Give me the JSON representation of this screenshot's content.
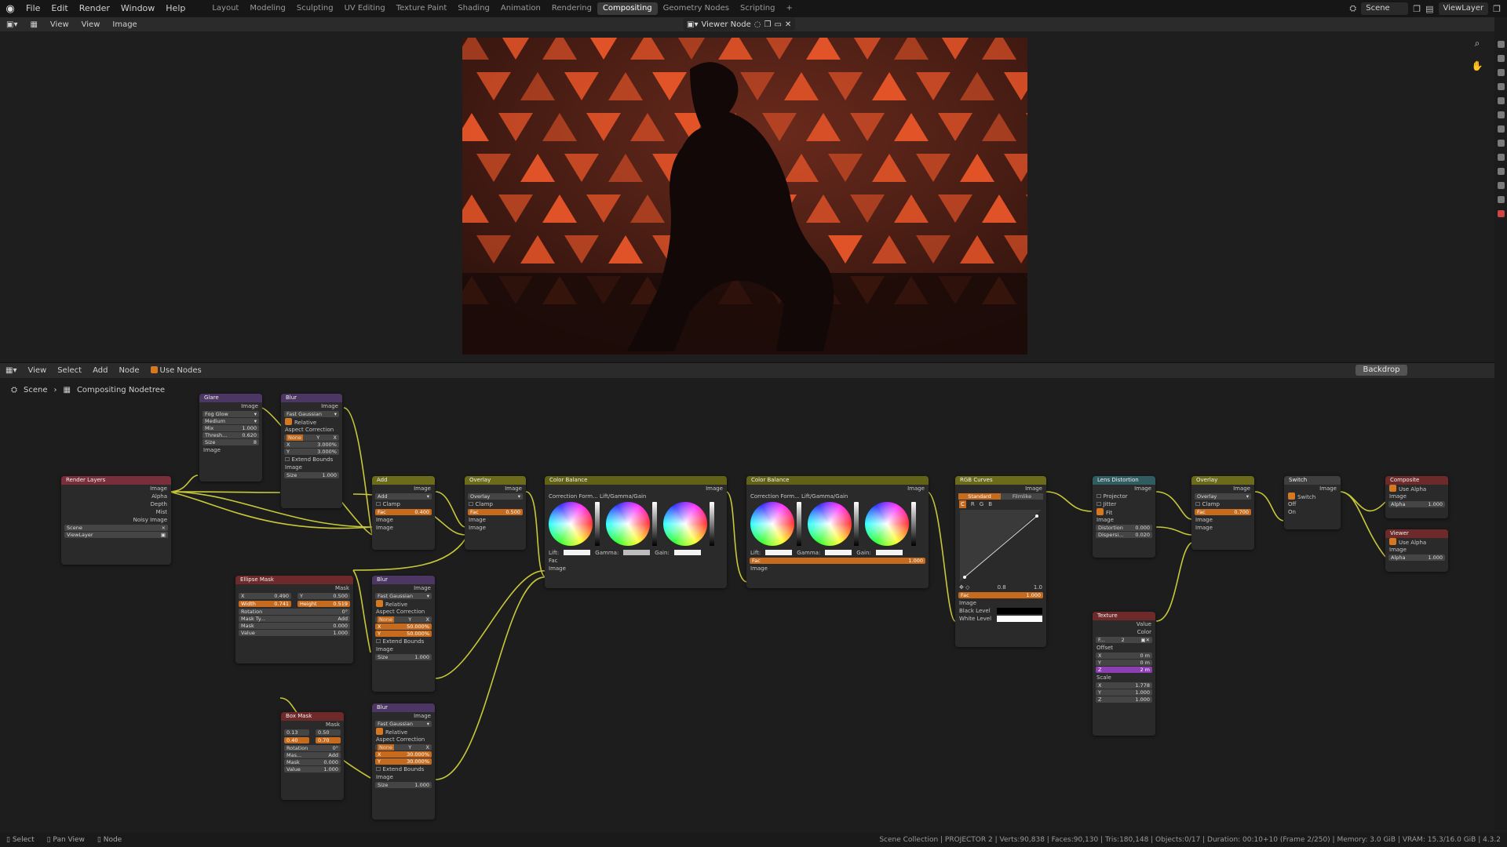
{
  "menu": {
    "file": "File",
    "edit": "Edit",
    "render": "Render",
    "window": "Window",
    "help": "Help"
  },
  "workspaces": [
    "Layout",
    "Modeling",
    "Sculpting",
    "UV Editing",
    "Texture Paint",
    "Shading",
    "Animation",
    "Rendering",
    "Compositing",
    "Geometry Nodes",
    "Scripting"
  ],
  "active_workspace": "Compositing",
  "scene_selector": "Scene",
  "viewlayer_selector": "ViewLayer",
  "image_editor": {
    "view": "View",
    "view2": "View",
    "image": "Image",
    "viewer_node": "Viewer Node"
  },
  "node_editor": {
    "view": "View",
    "select": "Select",
    "add": "Add",
    "node": "Node",
    "use_nodes": "Use Nodes",
    "backdrop": "Backdrop",
    "breadcrumb_scene": "Scene",
    "breadcrumb_tree": "Compositing Nodetree"
  },
  "nodes": {
    "render_layers": {
      "title": "Render Layers",
      "outputs": [
        "Image",
        "Alpha",
        "Depth",
        "Mist",
        "Noisy Image"
      ],
      "scene": "Scene",
      "layer": "ViewLayer"
    },
    "glare": {
      "title": "Glare",
      "out": "Image",
      "type": "Fog Glow",
      "quality": "Medium",
      "mix": "Mix",
      "mix_v": "1.000",
      "thresh": "Thresh...",
      "thresh_v": "0.620",
      "size": "Size",
      "size_v": "8",
      "in": "Image"
    },
    "blur1": {
      "title": "Blur",
      "out": "Image",
      "type": "Fast Gaussian",
      "relative": "Relative",
      "aspect": "Aspect Correction",
      "none": "None",
      "y": "Y",
      "x": "X",
      "xl": "X",
      "xv": "3.000%",
      "yl": "Y",
      "yv": "3.000%",
      "extend": "Extend Bounds",
      "in": "Image",
      "size": "Size",
      "size_v": "1.000"
    },
    "add": {
      "title": "Add",
      "out": "Image",
      "mode": "Add",
      "clamp": "Clamp",
      "fac": "Fac",
      "fac_v": "0.400",
      "in1": "Image",
      "in2": "Image"
    },
    "overlay1": {
      "title": "Overlay",
      "out": "Image",
      "mode": "Overlay",
      "clamp": "Clamp",
      "fac": "Fac",
      "fac_v": "0.500",
      "in1": "Image",
      "in2": "Image"
    },
    "cb1": {
      "title": "Color Balance",
      "out": "Image",
      "formula": "Correction Form...",
      "formula_v": "Lift/Gamma/Gain",
      "lift": "Lift:",
      "gamma": "Gamma:",
      "gain": "Gain:",
      "fac": "Fac",
      "in": "Image"
    },
    "cb2": {
      "title": "Color Balance",
      "out": "Image",
      "formula": "Correction Form...",
      "formula_v": "Lift/Gamma/Gain",
      "lift": "Lift:",
      "gamma": "Gamma:",
      "gain": "Gain:",
      "fac": "Fac",
      "fac_v": "1.000",
      "in": "Image"
    },
    "rgb_curves": {
      "title": "RGB Curves",
      "out": "Image",
      "standard": "Standard",
      "filmlike": "Filmlike",
      "c": "C",
      "r": "R",
      "g": "G",
      "b": "B",
      "v1": "0.8",
      "v2": "1.0",
      "fac": "Fac",
      "fac_v": "1.000",
      "in": "Image",
      "black": "Black Level",
      "white": "White Level"
    },
    "lens": {
      "title": "Lens Distortion",
      "out": "Image",
      "projector": "Projector",
      "jitter": "Jitter",
      "fit": "Fit",
      "in": "Image",
      "dist": "Distortion",
      "dist_v": "0.000",
      "disp": "Dispersi...",
      "disp_v": "0.020"
    },
    "overlay2": {
      "title": "Overlay",
      "out": "Image",
      "mode": "Overlay",
      "clamp": "Clamp",
      "fac": "Fac",
      "fac_v": "0.700",
      "in1": "Image",
      "in2": "Image"
    },
    "switch": {
      "title": "Switch",
      "out": "Image",
      "switch": "Switch",
      "off": "Off",
      "on": "On"
    },
    "composite": {
      "title": "Composite",
      "use_alpha": "Use Alpha",
      "in": "Image",
      "alpha": "Alpha",
      "alpha_v": "1.000"
    },
    "viewer": {
      "title": "Viewer",
      "use_alpha": "Use Alpha",
      "in": "Image",
      "alpha": "Alpha",
      "alpha_v": "1.000"
    },
    "ellipse": {
      "title": "Ellipse Mask",
      "out": "Mask",
      "x": "X",
      "x_v": "0.490",
      "y": "Y",
      "y_v": "0.500",
      "w": "Width",
      "w_v": "0.741",
      "h": "Height",
      "h_v": "0.519",
      "rot": "Rotation",
      "rot_v": "0°",
      "mtype": "Mask Ty...",
      "mtype_v": "Add",
      "mask": "Mask",
      "mask_v": "0.000",
      "value": "Value",
      "value_v": "1.000"
    },
    "blur2": {
      "title": "Blur",
      "out": "Image",
      "type": "Fast Gaussian",
      "relative": "Relative",
      "aspect": "Aspect Correction",
      "none": "None",
      "y": "Y",
      "x": "X",
      "xl": "X",
      "xv": "50.000%",
      "yl": "Y",
      "yv": "50.000%",
      "extend": "Extend Bounds",
      "in": "Image",
      "size": "Size",
      "size_v": "1.000"
    },
    "boxmask": {
      "title": "Box Mask",
      "out": "Mask",
      "a": "0.13",
      "b": "0.50",
      "c": "0.40",
      "d": "0.70",
      "rot": "Rotation",
      "rot_v": "0°",
      "mtype": "Mas...",
      "mtype_v": "Add",
      "mask": "Mask",
      "mask_v": "0.000",
      "value": "Value",
      "value_v": "1.000"
    },
    "blur3": {
      "title": "Blur",
      "out": "Image",
      "type": "Fast Gaussian",
      "relative": "Relative",
      "aspect": "Aspect Correction",
      "none": "None",
      "y": "Y",
      "x": "X",
      "xl": "X",
      "xv": "30.000%",
      "yl": "Y",
      "yv": "30.000%",
      "extend": "Extend Bounds",
      "in": "Image",
      "size": "Size",
      "size_v": "1.000"
    },
    "texture": {
      "title": "Texture",
      "value": "Value",
      "color": "Color",
      "tex": "F...",
      "tex_n": "2",
      "offset": "Offset",
      "x": "X",
      "x_v": "0 m",
      "y": "Y",
      "y_v": "0 m",
      "z": "Z",
      "z_v": "2 m",
      "scale": "Scale",
      "sx": "X",
      "sx_v": "1.778",
      "sy": "Y",
      "sy_v": "1.000",
      "sz": "Z",
      "sz_v": "1.000"
    }
  },
  "status": {
    "select": "Select",
    "pan": "Pan View",
    "node": "Node",
    "info": "Scene Collection | PROJECTOR 2 | Verts:90,838 | Faces:90,130 | Tris:180,148 | Objects:0/17 | Duration: 00:10+10 (Frame 2/250) | Memory: 3.0 GiB | VRAM: 15.3/16.0 GiB | 4.3.2"
  },
  "colors": {
    "accent": "#d6781f",
    "wire": "#c8c83a",
    "bg": "#1d1d1d"
  }
}
